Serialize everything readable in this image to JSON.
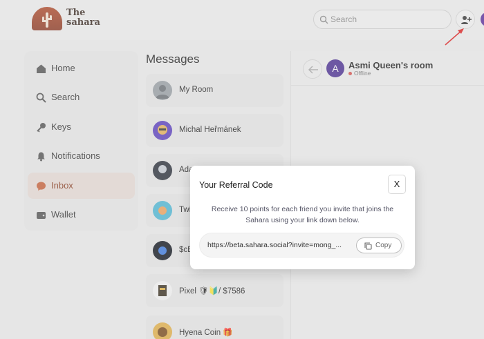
{
  "brand": {
    "line1": "The",
    "line2": "sahara"
  },
  "search": {
    "placeholder": "Search"
  },
  "sidebar": {
    "items": [
      {
        "label": "Home",
        "icon": "home-icon"
      },
      {
        "label": "Search",
        "icon": "search-icon"
      },
      {
        "label": "Keys",
        "icon": "key-icon"
      },
      {
        "label": "Notifications",
        "icon": "bell-icon"
      },
      {
        "label": "Inbox",
        "icon": "inbox-icon",
        "active": true
      },
      {
        "label": "Wallet",
        "icon": "wallet-icon"
      }
    ]
  },
  "messages": {
    "title": "Messages",
    "items": [
      {
        "name": "My Room"
      },
      {
        "name": "Michal Heřmánek"
      },
      {
        "name": "Ada"
      },
      {
        "name": "Twi"
      },
      {
        "name": "$cE"
      },
      {
        "name": "Pixel 🛡🔰/ $7586"
      },
      {
        "name": "Hyena Coin 🎁"
      }
    ]
  },
  "chat": {
    "room_title": "Asmi Queen's room",
    "avatar_letter": "A",
    "status": "Offline"
  },
  "modal": {
    "title": "Your Referral Code",
    "close_label": "X",
    "description": "Receive 10 points for each friend you invite that joins the Sahara using your link down below.",
    "link": "https://beta.sahara.social?invite=mong_...",
    "copy_label": "Copy"
  },
  "colors": {
    "accent": "#8a3b1f",
    "room_avatar": "#4b2f93",
    "offline_dot": "#d9534f"
  }
}
